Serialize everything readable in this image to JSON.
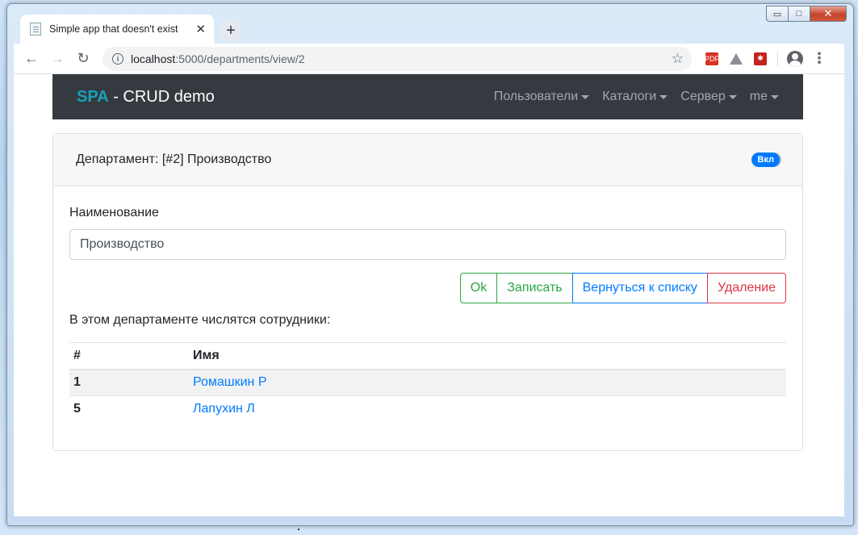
{
  "browser": {
    "tab_title": "Simple app that doesn't exist",
    "tab_close": "✕",
    "new_tab": "+",
    "url_host": "localhost",
    "url_path": ":5000/departments/view/2",
    "back_icon": "←",
    "forward_icon": "→",
    "reload_icon": "↻",
    "star_icon": "☆",
    "menu_icon": "⋮",
    "info_icon": "i",
    "pdf_icon": "PDF",
    "red_ext_icon": "✱"
  },
  "window": {
    "minimize": "▭",
    "maximize": "□",
    "close": "✕"
  },
  "navbar": {
    "brand_spa": "SPA",
    "brand_rest": " - CRUD demo",
    "items": [
      {
        "label": "Пользователи"
      },
      {
        "label": "Каталоги"
      },
      {
        "label": "Сервер"
      },
      {
        "label": "me"
      }
    ]
  },
  "card": {
    "header_title": "Департамент: [#2] Производство",
    "switch_label": "Вкл",
    "name_label": "Наименование",
    "name_value": "Производство",
    "buttons": {
      "ok": "Ok",
      "save": "Записать",
      "back": "Вернуться к списку",
      "delete": "Удаление"
    },
    "employees_caption": "В этом департаменте числятся сотрудники:",
    "table": {
      "headers": [
        "#",
        "Имя"
      ],
      "rows": [
        {
          "id": "1",
          "name": "Ромашкин Р"
        },
        {
          "id": "5",
          "name": "Лапухин Л"
        }
      ]
    }
  },
  "colors": {
    "navbar_bg": "#343a40",
    "brand_accent": "#17a2b8",
    "primary": "#007bff",
    "success": "#28a745",
    "danger": "#dc3545"
  }
}
